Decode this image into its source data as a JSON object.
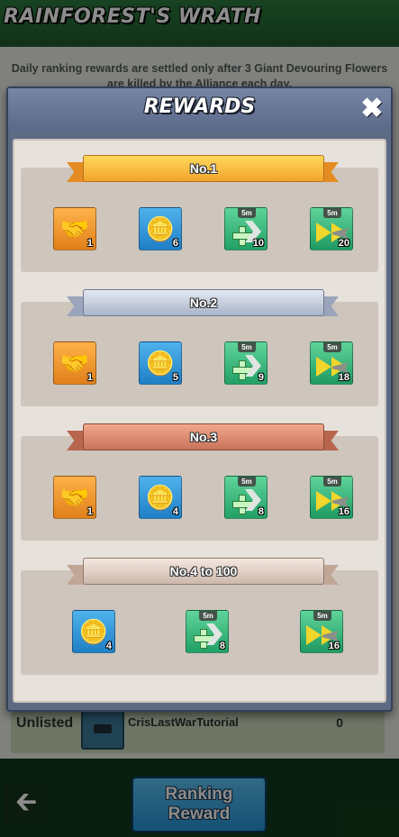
{
  "page": {
    "title": "RAINFOREST'S WRATH",
    "notice": "Daily ranking rewards are settled only after 3 Giant Devouring Flowers are killed by the Alliance each day.",
    "player_row": {
      "rank": "Unlisted",
      "name": "CrisLastWarTutorial",
      "score": "0"
    },
    "back_icon": "arrow-left-icon",
    "ranking_reward_button": {
      "line1": "Ranking",
      "line2": "Reward"
    }
  },
  "modal": {
    "title": "REWARDS",
    "close_icon": "close-x-icon",
    "sections": [
      {
        "label": "No.1",
        "tier_color": "#f7b53a",
        "items": [
          {
            "icon": "gold-handshake-icon",
            "qty": "1"
          },
          {
            "icon": "gold-coins-chest-icon",
            "qty": "6"
          },
          {
            "icon": "speedup-plus-icon",
            "duration": "5m",
            "qty": "10"
          },
          {
            "icon": "speedup-build-icon",
            "duration": "5m",
            "qty": "20"
          }
        ]
      },
      {
        "label": "No.2",
        "tier_color": "#b7c0d2",
        "items": [
          {
            "icon": "silver-handshake-icon",
            "qty": "1"
          },
          {
            "icon": "gold-coins-chest-icon",
            "qty": "5"
          },
          {
            "icon": "speedup-plus-icon",
            "duration": "5m",
            "qty": "9"
          },
          {
            "icon": "speedup-build-icon",
            "duration": "5m",
            "qty": "18"
          }
        ]
      },
      {
        "label": "No.3",
        "tier_color": "#d88268",
        "items": [
          {
            "icon": "bronze-handshake-icon",
            "qty": "1"
          },
          {
            "icon": "gold-coins-chest-icon",
            "qty": "4"
          },
          {
            "icon": "speedup-plus-icon",
            "duration": "5m",
            "qty": "8"
          },
          {
            "icon": "speedup-build-icon",
            "duration": "5m",
            "qty": "16"
          }
        ]
      },
      {
        "label": "No.4 to 100",
        "tier_color": "#d8c3b6",
        "items": [
          {
            "icon": "gold-coins-chest-icon",
            "qty": "4"
          },
          {
            "icon": "speedup-plus-icon",
            "duration": "5m",
            "qty": "8"
          },
          {
            "icon": "speedup-build-icon",
            "duration": "5m",
            "qty": "16"
          }
        ]
      }
    ]
  }
}
